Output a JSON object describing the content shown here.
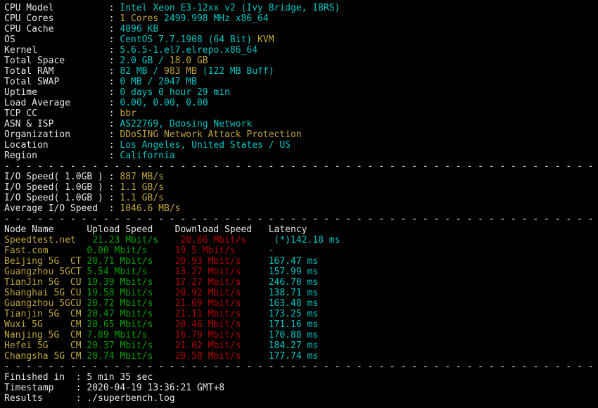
{
  "terminal": {
    "background": "#000000",
    "colors": {
      "white": "#e6e6e6",
      "cyan": "#00c4c4",
      "green": "#00a000",
      "yellow": "#c0a53a",
      "red": "#b40000",
      "separator": "#ffffff"
    },
    "separator_line": "- - - - - - - - - - - - - - - - - - - - - - - - - - - - - - - - - - - - - - - - - - - - - - - - - - - - - - - -"
  },
  "system_info": {
    "rows": [
      {
        "label": "CPU Model",
        "value_parts": [
          {
            "text": "Intel Xeon E3-12xx v2 (Ivy Bridge, IBRS)",
            "color": "cyan"
          }
        ]
      },
      {
        "label": "CPU Cores",
        "value_parts": [
          {
            "text": "1 Cores ",
            "color": "yellow"
          },
          {
            "text": "2499.998 MHz x86_64",
            "color": "cyan"
          }
        ]
      },
      {
        "label": "CPU Cache",
        "value_parts": [
          {
            "text": "4096 KB",
            "color": "cyan"
          }
        ]
      },
      {
        "label": "OS",
        "value_parts": [
          {
            "text": "CentOS 7.7.1908 (64 Bit) ",
            "color": "cyan"
          },
          {
            "text": "KVM",
            "color": "yellow"
          }
        ]
      },
      {
        "label": "Kernel",
        "value_parts": [
          {
            "text": "5.6.5-1.el7.elrepo.x86_64",
            "color": "cyan"
          }
        ]
      },
      {
        "label": "Total Space",
        "value_parts": [
          {
            "text": "2.0 GB / ",
            "color": "cyan"
          },
          {
            "text": "18.0 GB",
            "color": "yellow"
          }
        ]
      },
      {
        "label": "Total RAM",
        "value_parts": [
          {
            "text": "82 MB / ",
            "color": "cyan"
          },
          {
            "text": "983 MB",
            "color": "yellow"
          },
          {
            "text": " (122 MB Buff)",
            "color": "cyan"
          }
        ]
      },
      {
        "label": "Total SWAP",
        "value_parts": [
          {
            "text": "0 MB / 2047 MB",
            "color": "cyan"
          }
        ]
      },
      {
        "label": "Uptime",
        "value_parts": [
          {
            "text": "0 days 0 hour 29 min",
            "color": "cyan"
          }
        ]
      },
      {
        "label": "Load Average",
        "value_parts": [
          {
            "text": "0.00, 0.00, 0.00",
            "color": "cyan"
          }
        ]
      },
      {
        "label": "TCP CC",
        "value_parts": [
          {
            "text": "bbr",
            "color": "yellow"
          }
        ]
      },
      {
        "label": "ASN & ISP",
        "value_parts": [
          {
            "text": "AS22769, Ddosing Network",
            "color": "cyan"
          }
        ]
      },
      {
        "label": "Organization",
        "value_parts": [
          {
            "text": "DDoSING Network Attack Protection",
            "color": "yellow"
          }
        ]
      },
      {
        "label": "Location",
        "value_parts": [
          {
            "text": "Los Angeles, United States / US",
            "color": "cyan"
          }
        ]
      },
      {
        "label": "Region",
        "value_parts": [
          {
            "text": "California",
            "color": "cyan"
          }
        ]
      }
    ]
  },
  "io_test": {
    "rows": [
      {
        "label": "I/O Speed( 1.0GB )",
        "value": "887 MB/s",
        "color": "yellow"
      },
      {
        "label": "I/O Speed( 1.0GB )",
        "value": "1.1 GB/s",
        "color": "yellow"
      },
      {
        "label": "I/O Speed( 1.0GB )",
        "value": "1.1 GB/s",
        "color": "yellow"
      },
      {
        "label": "Average I/O Speed",
        "value": "1046.6 MB/s",
        "color": "yellow"
      }
    ]
  },
  "speedtest": {
    "headers": {
      "node_name": "Node Name",
      "upload_speed": "Upload Speed",
      "download_speed": "Download Speed",
      "latency": "Latency"
    },
    "rows": [
      {
        "node": "Speedtest.net",
        "isp": "",
        "upload": "21.23 Mbit/s",
        "download": "20.66 Mbit/s",
        "latency": "(*)142.18 ms"
      },
      {
        "node": "Fast.com",
        "isp": "",
        "upload": "0.00 Mbit/s",
        "download": "19.5 Mbit/s",
        "latency": "-"
      },
      {
        "node": "Beijing 5G",
        "isp": "CT",
        "upload": "20.71 Mbit/s",
        "download": "20.93 Mbit/s",
        "latency": "167.47 ms"
      },
      {
        "node": "Guangzhou 5G",
        "isp": "CT",
        "upload": "5.54 Mbit/s",
        "download": "13.27 Mbit/s",
        "latency": "157.99 ms"
      },
      {
        "node": "TianJin 5G",
        "isp": "CU",
        "upload": "19.39 Mbit/s",
        "download": "17.27 Mbit/s",
        "latency": "246.70 ms"
      },
      {
        "node": "Shanghai 5G",
        "isp": "CU",
        "upload": "19.58 Mbit/s",
        "download": "20.92 Mbit/s",
        "latency": "138.71 ms"
      },
      {
        "node": "Guangzhou 5G",
        "isp": "CU",
        "upload": "20.72 Mbit/s",
        "download": "21.09 Mbit/s",
        "latency": "163.48 ms"
      },
      {
        "node": "Tianjin 5G",
        "isp": "CM",
        "upload": "20.47 Mbit/s",
        "download": "21.11 Mbit/s",
        "latency": "173.25 ms"
      },
      {
        "node": "Wuxi 5G",
        "isp": "CM",
        "upload": "20.65 Mbit/s",
        "download": "20.46 Mbit/s",
        "latency": "171.16 ms"
      },
      {
        "node": "Nanjing 5G",
        "isp": "CM",
        "upload": "7.89 Mbit/s",
        "download": "16.79 Mbit/s",
        "latency": "170.88 ms"
      },
      {
        "node": "Hefei 5G",
        "isp": "CM",
        "upload": "20.37 Mbit/s",
        "download": "21.02 Mbit/s",
        "latency": "184.27 ms"
      },
      {
        "node": "Changsha 5G",
        "isp": "CM",
        "upload": "20.74 Mbit/s",
        "download": "20.58 Mbit/s",
        "latency": "177.74 ms"
      }
    ]
  },
  "footer": {
    "rows": [
      {
        "label": "Finished in",
        "value": "5 min 35 sec"
      },
      {
        "label": "Timestamp",
        "value": "2020-04-19 13:36:21 GMT+8"
      },
      {
        "label": "Results",
        "value": "./superbench.log"
      }
    ]
  }
}
